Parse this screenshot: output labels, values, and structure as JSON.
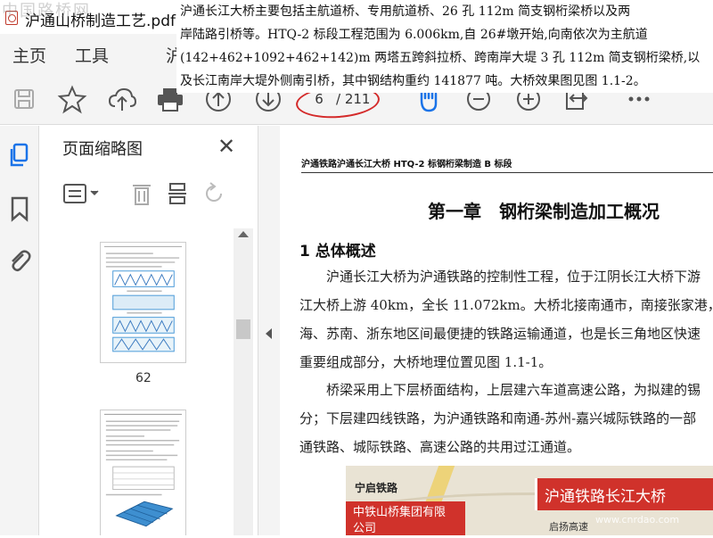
{
  "window": {
    "title": "沪通山桥制造工艺.pdf - A",
    "watermark_top": "中国路桥网",
    "watermark_bottom": "www.cnrdao.com"
  },
  "menu": {
    "items": [
      "主页",
      "工具",
      "沪"
    ]
  },
  "overlay_text": {
    "lines": [
      "沪通长江大桥主要包括主航道桥、专用航道桥、26 孔 112m 简支钢桁梁桥以及两",
      "岸陆路引桥等。HTQ-2 标段工程范围为 6.006km,自 26#墩开始,向南依次为主航道",
      "(142+462+1092+462+142)m 两塔五跨斜拉桥、跨南岸大堤 3 孔 112m 简支钢桁梁桥,以",
      "及长江南岸大堤外侧南引桥，其中钢结构重约 141877 吨。大桥效果图见图 1.1-2。"
    ]
  },
  "toolbar": {
    "icons": [
      "save-icon",
      "star-icon",
      "cloud-upload-icon",
      "print-icon",
      "page-up-icon",
      "page-down-icon",
      "hand-icon",
      "zoom-out-icon",
      "zoom-in-icon",
      "fit-page-icon",
      "more-icon"
    ],
    "current_page": "6",
    "total_pages": "/ 211"
  },
  "sidebar": {
    "icons": [
      "pages-icon",
      "bookmark-icon",
      "attachment-icon"
    ]
  },
  "thumbnails": {
    "title": "页面缩略图",
    "close": "✕",
    "pages": [
      {
        "label": "62"
      }
    ]
  },
  "document": {
    "header": "沪通铁路沪通长江大桥 HTQ-2 标钢桁梁制造 B 标段",
    "chapter": "第一章　钢桁梁制造加工概况",
    "section": "1 总体概述",
    "para1": [
      "　　沪通长江大桥为沪通铁路的控制性工程，位于江阴长江大桥下游",
      "江大桥上游 40km，全长 11.072km。大桥北接南通市，南接张家港，是",
      "海、苏南、浙东地区间最便捷的铁路运输通道，也是长三角地区快速",
      "重要组成部分，大桥地理位置见图 1.1-1。"
    ],
    "para2": [
      "　　桥梁采用上下层桥面结构，上层建六车道高速公路，为拟建的锡",
      "分；下层建四线铁路，为沪通铁路和南通-苏州-嘉兴城际铁路的一部",
      "通铁路、城际铁路、高速公路的共用过江通道。"
    ],
    "map": {
      "label_ningqi": "宁启铁路",
      "company": "中铁山桥集团有限",
      "company2": "公司",
      "bridge": "沪通铁路长江大桥",
      "qidong": "启扬高速"
    }
  }
}
